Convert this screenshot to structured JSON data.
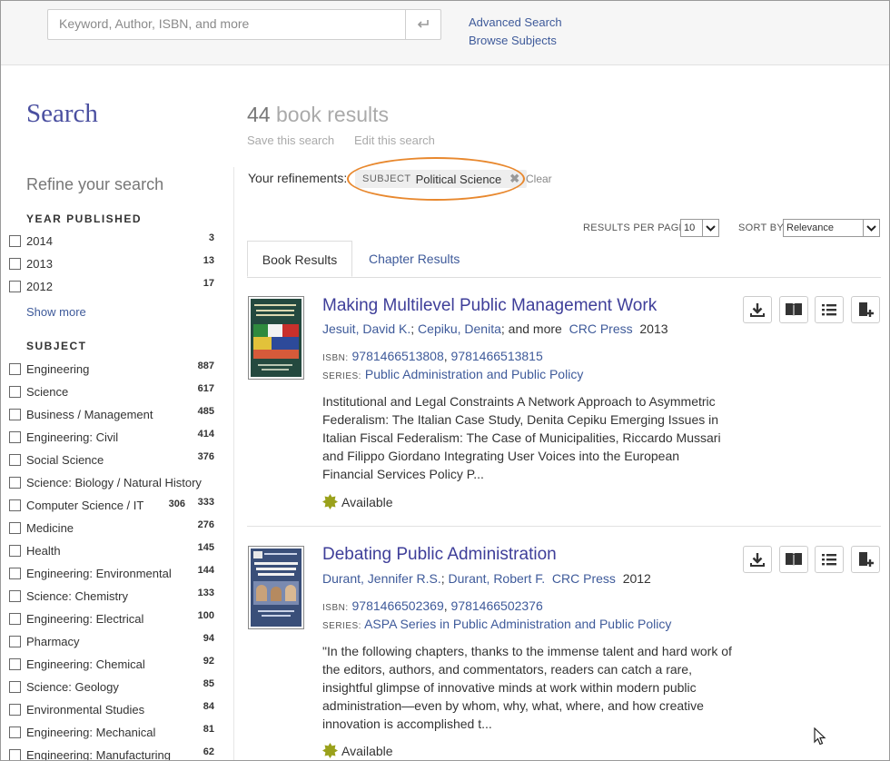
{
  "search": {
    "placeholder": "Keyword, Author, ISBN, and more",
    "advanced_link": "Advanced Search",
    "browse_link": "Browse Subjects",
    "submit_icon": "enter-icon"
  },
  "page": {
    "title": "Search",
    "result_number": "44",
    "result_label": "book results",
    "save_search": "Save this search",
    "edit_search": "Edit this search"
  },
  "sidebar": {
    "refine_title": "Refine your search",
    "year_heading": "YEAR PUBLISHED",
    "years": [
      {
        "label": "2014",
        "count": "3"
      },
      {
        "label": "2013",
        "count": "13"
      },
      {
        "label": "2012",
        "count": "17"
      }
    ],
    "show_more": "Show more",
    "subject_heading": "SUBJECT",
    "subjects": [
      {
        "label": "Engineering",
        "count": "887"
      },
      {
        "label": "Science",
        "count": "617"
      },
      {
        "label": "Business / Management",
        "count": "485"
      },
      {
        "label": "Engineering: Civil",
        "count": "414"
      },
      {
        "label": "Social Science",
        "count": "376"
      },
      {
        "label": "Science: Biology / Natural History",
        "count": ""
      },
      {
        "label": "Computer Science / IT",
        "count": "333",
        "extra": "306"
      },
      {
        "label": "Medicine",
        "count": "276"
      },
      {
        "label": "Health",
        "count": "145"
      },
      {
        "label": "Engineering: Environmental",
        "count": "144"
      },
      {
        "label": "Science: Chemistry",
        "count": "133"
      },
      {
        "label": "Engineering: Electrical",
        "count": "100"
      },
      {
        "label": "Pharmacy",
        "count": "94"
      },
      {
        "label": "Engineering: Chemical",
        "count": "92"
      },
      {
        "label": "Science: Geology",
        "count": "85"
      },
      {
        "label": "Environmental Studies",
        "count": "84"
      },
      {
        "label": "Engineering: Mechanical",
        "count": "81"
      },
      {
        "label": "Engineering: Manufacturing",
        "count": "62"
      }
    ]
  },
  "refinements": {
    "label": "Your refinements:",
    "chip_type": "SUBJECT",
    "chip_value": "Political Science",
    "clear": "Clear",
    "highlight_color": "#e8882e"
  },
  "controls": {
    "per_page_label": "RESULTS PER PAGE",
    "per_page_value": "10",
    "sort_label": "SORT BY",
    "sort_value": "Relevance"
  },
  "tabs": {
    "book": "Book Results",
    "chapter": "Chapter Results"
  },
  "results": [
    {
      "title": "Making Multilevel Public Management Work",
      "author1": "Jesuit, David K.",
      "author2": "Cepiku, Denita",
      "and_more": "; and more",
      "publisher": "CRC Press",
      "year": "2013",
      "isbn_label": "ISBN:",
      "isbn1": "9781466513808",
      "isbn2": "9781466513815",
      "series_label": "SERIES:",
      "series": "Public Administration and Public Policy",
      "description": "Institutional and Legal Constraints A Network Approach to Asymmetric Federalism: The Italian Case Study, Denita Cepiku Emerging Issues in Italian Fiscal Federalism: The Case of Municipalities, Riccardo Mussari and Filippo Giordano Integrating User Voices into the European Financial Services Policy P...",
      "availability": "Available",
      "cover_color": "#2a5a4c"
    },
    {
      "title": "Debating Public Administration",
      "author1": "Durant, Jennifer R.S.",
      "author2": "Durant, Robert F.",
      "and_more": "",
      "publisher": "CRC Press",
      "year": "2012",
      "isbn_label": "ISBN:",
      "isbn1": "9781466502369",
      "isbn2": "9781466502376",
      "series_label": "SERIES:",
      "series": "ASPA Series in Public Administration and Public Policy",
      "description": "\"In the following chapters, thanks to the immense talent and hard work of the editors, authors, and commentators, readers can catch a rare, insightful glimpse of innovative minds at work within modern public administration—even by whom, why, what, where, and how creative innovation is accomplished t...",
      "availability": "Available",
      "cover_color": "#3b4f7a"
    }
  ],
  "colors": {
    "link": "#3e5a9a",
    "title": "#3e3e99",
    "available_badge": "#9aa11b"
  }
}
